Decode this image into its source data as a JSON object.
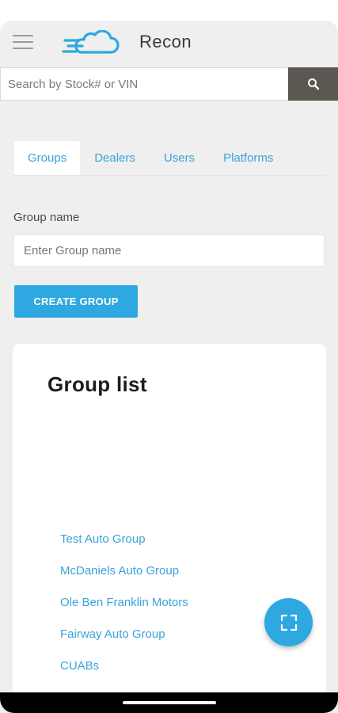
{
  "header": {
    "menu_icon": "hamburger-menu-icon",
    "logo_icon": "cloud-speed-logo-icon",
    "title": "Recon"
  },
  "search": {
    "placeholder": "Search by Stock# or VIN",
    "value": "",
    "button_icon": "search-icon"
  },
  "tabs": [
    {
      "label": "Groups",
      "active": true
    },
    {
      "label": "Dealers",
      "active": false
    },
    {
      "label": "Users",
      "active": false
    },
    {
      "label": "Platforms",
      "active": false
    }
  ],
  "form": {
    "label": "Group name",
    "placeholder": "Enter Group name",
    "value": "",
    "create_label": "CREATE GROUP"
  },
  "group_list": {
    "title": "Group list",
    "items": [
      "Test Auto Group",
      "McDaniels Auto Group",
      "Ole Ben Franklin Motors",
      "Fairway Auto Group",
      "CUABs"
    ]
  },
  "fab": {
    "icon": "fullscreen-icon"
  },
  "colors": {
    "accent": "#2ea8e0",
    "link": "#3aa3dc",
    "search_button": "#5b5852",
    "background": "#efefef",
    "logo": "#2ea8e0"
  }
}
